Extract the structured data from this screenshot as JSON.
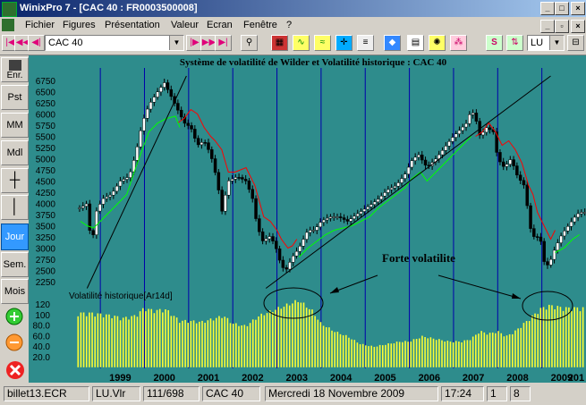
{
  "window": {
    "title": "WinixPro 7  - [CAC 40 : FR0003500008]"
  },
  "menu": [
    "Fichier",
    "Figures",
    "Présentation",
    "Valeur",
    "Ecran",
    "Fenêtre",
    "?"
  ],
  "toolbar": {
    "instrument": "CAC 40",
    "period_select": "LU"
  },
  "sidebar": {
    "enr": "Enr.",
    "pst": "Pst",
    "mm": "MM",
    "mdl": "Mdl",
    "jour": "Jour",
    "sem": "Sem.",
    "mois": "Mois"
  },
  "chart": {
    "title": "Système de volatilité de Wilder et Volatilité historique : CAC 40",
    "annotation": "Forte volatilite",
    "indicator_label": "Volatilité historique[Ar14d]",
    "colors": {
      "background": "#2e8c8c",
      "candle_up": "#ffffff",
      "candle_down": "#000000",
      "wilder_red": "#ff0000",
      "wilder_green": "#00ff00",
      "bars": "#ffff33",
      "year_lines": "#0000aa"
    }
  },
  "chart_data": {
    "type": "candlestick",
    "title": "Système de volatilité de Wilder et Volatilité historique : CAC 40",
    "x_ticks": [
      "1999",
      "2000",
      "2001",
      "2002",
      "2003",
      "2004",
      "2005",
      "2006",
      "2007",
      "2008",
      "2009",
      "201"
    ],
    "price_ticks": [
      6750,
      6500,
      6250,
      6000,
      5750,
      5500,
      5250,
      5000,
      4750,
      4500,
      4250,
      4000,
      3750,
      3500,
      3250,
      3000,
      2750,
      2500,
      2250
    ],
    "price_range": [
      2100,
      6850
    ],
    "vol_ticks": [
      120,
      100,
      80.0,
      60.0,
      40.0,
      20.0
    ],
    "vol_tick_labels": [
      "120",
      "100",
      "80.0",
      "60.0",
      "40.0",
      "20.0"
    ],
    "vol_range": [
      0,
      140
    ],
    "price_series": [
      [
        1998.55,
        3900
      ],
      [
        1998.7,
        4000
      ],
      [
        1998.8,
        3000
      ],
      [
        1998.9,
        3800
      ],
      [
        1999.05,
        4100
      ],
      [
        1999.25,
        4200
      ],
      [
        1999.45,
        4500
      ],
      [
        1999.65,
        4600
      ],
      [
        1999.8,
        5100
      ],
      [
        1999.95,
        5800
      ],
      [
        2000.1,
        6200
      ],
      [
        2000.3,
        6500
      ],
      [
        2000.45,
        6700
      ],
      [
        2000.6,
        6400
      ],
      [
        2000.75,
        6100
      ],
      [
        2000.9,
        5800
      ],
      [
        2001.05,
        5700
      ],
      [
        2001.2,
        5300
      ],
      [
        2001.35,
        5400
      ],
      [
        2001.5,
        5100
      ],
      [
        2001.65,
        4500
      ],
      [
        2001.75,
        3800
      ],
      [
        2001.9,
        4500
      ],
      [
        2002.1,
        4600
      ],
      [
        2002.3,
        4500
      ],
      [
        2002.45,
        4100
      ],
      [
        2002.55,
        3500
      ],
      [
        2002.7,
        3100
      ],
      [
        2002.8,
        3300
      ],
      [
        2002.95,
        3100
      ],
      [
        2003.1,
        2600
      ],
      [
        2003.2,
        2500
      ],
      [
        2003.35,
        2800
      ],
      [
        2003.5,
        3000
      ],
      [
        2003.7,
        3400
      ],
      [
        2003.85,
        3400
      ],
      [
        2004.0,
        3600
      ],
      [
        2004.2,
        3700
      ],
      [
        2004.4,
        3700
      ],
      [
        2004.6,
        3600
      ],
      [
        2004.8,
        3750
      ],
      [
        2004.95,
        3850
      ],
      [
        2005.1,
        3950
      ],
      [
        2005.3,
        4100
      ],
      [
        2005.5,
        4300
      ],
      [
        2005.7,
        4400
      ],
      [
        2005.9,
        4650
      ],
      [
        2006.05,
        4950
      ],
      [
        2006.2,
        5100
      ],
      [
        2006.4,
        4800
      ],
      [
        2006.6,
        5000
      ],
      [
        2006.8,
        5250
      ],
      [
        2006.95,
        5450
      ],
      [
        2007.1,
        5600
      ],
      [
        2007.3,
        5800
      ],
      [
        2007.4,
        6100
      ],
      [
        2007.5,
        5900
      ],
      [
        2007.6,
        5500
      ],
      [
        2007.75,
        5700
      ],
      [
        2007.9,
        5600
      ],
      [
        2008.0,
        5000
      ],
      [
        2008.15,
        4800
      ],
      [
        2008.3,
        5000
      ],
      [
        2008.45,
        4600
      ],
      [
        2008.6,
        4400
      ],
      [
        2008.75,
        3400
      ],
      [
        2008.85,
        3200
      ],
      [
        2008.95,
        3300
      ],
      [
        2009.05,
        2700
      ],
      [
        2009.15,
        2600
      ],
      [
        2009.3,
        3000
      ],
      [
        2009.45,
        3300
      ],
      [
        2009.6,
        3500
      ],
      [
        2009.75,
        3700
      ],
      [
        2009.85,
        3800
      ],
      [
        2009.95,
        3800
      ]
    ],
    "wilder_red": [
      [
        2000.75,
        5800
      ],
      [
        2000.9,
        5900
      ],
      [
        2001.05,
        6100
      ],
      [
        2001.2,
        6000
      ],
      [
        2001.35,
        5700
      ],
      [
        2001.5,
        5500
      ],
      [
        2001.6,
        5400
      ],
      [
        2001.75,
        5200
      ],
      [
        2001.9,
        4700
      ],
      [
        2002.05,
        4700
      ],
      [
        2002.3,
        4800
      ],
      [
        2002.5,
        4400
      ],
      [
        2002.7,
        3700
      ],
      [
        2002.85,
        3600
      ],
      [
        2003.0,
        3400
      ],
      [
        2003.1,
        3200
      ],
      [
        2003.25,
        3000
      ],
      [
        2003.35,
        3050
      ],
      [
        2003.45,
        3200
      ],
      [
        2007.5,
        5500
      ],
      [
        2007.65,
        5600
      ],
      [
        2007.8,
        5800
      ],
      [
        2007.95,
        5600
      ],
      [
        2008.1,
        5300
      ],
      [
        2008.25,
        5400
      ],
      [
        2008.4,
        5200
      ],
      [
        2008.55,
        4900
      ],
      [
        2008.7,
        4400
      ],
      [
        2008.8,
        4200
      ],
      [
        2008.9,
        3800
      ],
      [
        2009.0,
        3600
      ],
      [
        2009.1,
        3400
      ],
      [
        2009.2,
        3200
      ],
      [
        2009.3,
        3400
      ]
    ],
    "wilder_green": [
      [
        1998.55,
        3600
      ],
      [
        1998.7,
        3500
      ],
      [
        1998.85,
        3450
      ],
      [
        1999.0,
        3600
      ],
      [
        1999.2,
        3800
      ],
      [
        1999.4,
        4000
      ],
      [
        1999.6,
        4200
      ],
      [
        1999.8,
        4800
      ],
      [
        1999.95,
        5200
      ],
      [
        2000.1,
        5600
      ],
      [
        2000.3,
        5800
      ],
      [
        2000.5,
        5900
      ],
      [
        2000.7,
        5950
      ],
      [
        2000.8,
        5700
      ],
      [
        2003.5,
        2800
      ],
      [
        2003.7,
        3000
      ],
      [
        2003.9,
        3150
      ],
      [
        2004.1,
        3300
      ],
      [
        2004.3,
        3400
      ],
      [
        2004.5,
        3450
      ],
      [
        2004.7,
        3500
      ],
      [
        2004.9,
        3600
      ],
      [
        2005.1,
        3700
      ],
      [
        2005.3,
        3900
      ],
      [
        2005.5,
        4050
      ],
      [
        2005.7,
        4200
      ],
      [
        2005.9,
        4350
      ],
      [
        2006.05,
        4550
      ],
      [
        2006.25,
        4700
      ],
      [
        2006.4,
        4500
      ],
      [
        2006.6,
        4700
      ],
      [
        2006.8,
        4900
      ],
      [
        2007.0,
        5100
      ],
      [
        2007.2,
        5300
      ],
      [
        2007.4,
        5500
      ],
      [
        2009.3,
        2900
      ],
      [
        2009.5,
        3000
      ],
      [
        2009.7,
        3200
      ],
      [
        2009.85,
        3300
      ]
    ],
    "trendlines": [
      {
        "from": [
          1998.7,
          2100
        ],
        "to": [
          2000.95,
          6850
        ]
      },
      {
        "from": [
          2002.75,
          2100
        ],
        "to": [
          2009.2,
          6850
        ]
      }
    ],
    "volatility_series": [
      [
        1998.5,
        105
      ],
      [
        1998.8,
        105
      ],
      [
        1999.0,
        103
      ],
      [
        1999.3,
        100
      ],
      [
        1999.5,
        95
      ],
      [
        1999.8,
        100
      ],
      [
        2000.0,
        115
      ],
      [
        2000.2,
        110
      ],
      [
        2000.5,
        112
      ],
      [
        2000.8,
        90
      ],
      [
        2001.0,
        90
      ],
      [
        2001.3,
        88
      ],
      [
        2001.6,
        95
      ],
      [
        2001.8,
        100
      ],
      [
        2002.0,
        85
      ],
      [
        2002.3,
        80
      ],
      [
        2002.6,
        100
      ],
      [
        2002.9,
        110
      ],
      [
        2003.2,
        120
      ],
      [
        2003.5,
        130
      ],
      [
        2003.8,
        110
      ],
      [
        2004.0,
        85
      ],
      [
        2004.3,
        70
      ],
      [
        2004.6,
        60
      ],
      [
        2004.9,
        45
      ],
      [
        2005.2,
        40
      ],
      [
        2005.5,
        45
      ],
      [
        2005.8,
        50
      ],
      [
        2006.0,
        50
      ],
      [
        2006.3,
        60
      ],
      [
        2006.6,
        55
      ],
      [
        2006.9,
        50
      ],
      [
        2007.2,
        50
      ],
      [
        2007.4,
        55
      ],
      [
        2007.6,
        70
      ],
      [
        2007.8,
        65
      ],
      [
        2008.0,
        70
      ],
      [
        2008.2,
        60
      ],
      [
        2008.4,
        70
      ],
      [
        2008.6,
        85
      ],
      [
        2008.8,
        100
      ],
      [
        2009.0,
        115
      ],
      [
        2009.2,
        120
      ],
      [
        2009.5,
        115
      ],
      [
        2009.8,
        115
      ]
    ]
  },
  "status": {
    "file": "billet13.ECR",
    "list": "LU.Vlr",
    "count": "111/698",
    "instrument": "CAC 40",
    "date": "Mercredi 18 Novembre 2009",
    "time": "17:24",
    "n1": "1",
    "n2": "8"
  }
}
